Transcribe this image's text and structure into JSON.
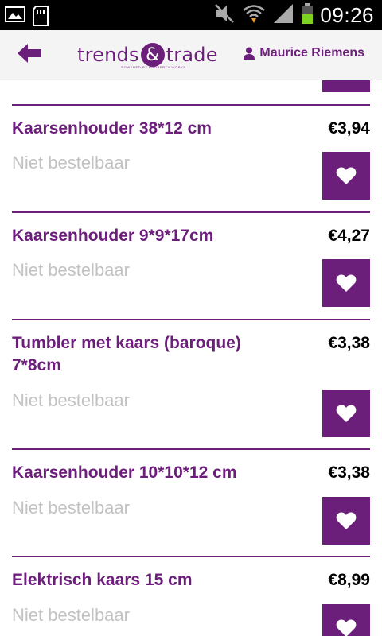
{
  "statusbar": {
    "time": "09:26",
    "left_icons": [
      "gallery-icon",
      "sd-card-icon"
    ],
    "right_icons": [
      "mute-icon",
      "wifi-icon",
      "signal-icon",
      "battery-icon"
    ]
  },
  "header": {
    "logo_part1": "trends",
    "logo_amp": "&",
    "logo_part2": "trade",
    "logo_tagline": "POWERED BY PROPERTY WORKS",
    "user_name": "Maurice Riemens"
  },
  "products": [
    {
      "name": "Kaarsenhouder 38*12 cm",
      "price": "€3,94",
      "status": "Niet bestelbaar"
    },
    {
      "name": "Kaarsenhouder 9*9*17cm",
      "price": "€4,27",
      "status": "Niet bestelbaar"
    },
    {
      "name": "Tumbler met kaars (baroque) 7*8cm",
      "price": "€3,38",
      "status": "Niet bestelbaar"
    },
    {
      "name": "Kaarsenhouder 10*10*12 cm",
      "price": "€3,38",
      "status": "Niet bestelbaar"
    },
    {
      "name": "Elektrisch kaars 15 cm",
      "price": "€8,99",
      "status": "Niet bestelbaar"
    }
  ],
  "colors": {
    "accent": "#6c1f7a",
    "status_text": "#c2c2c2",
    "header_bg": "#f4f4f4"
  }
}
